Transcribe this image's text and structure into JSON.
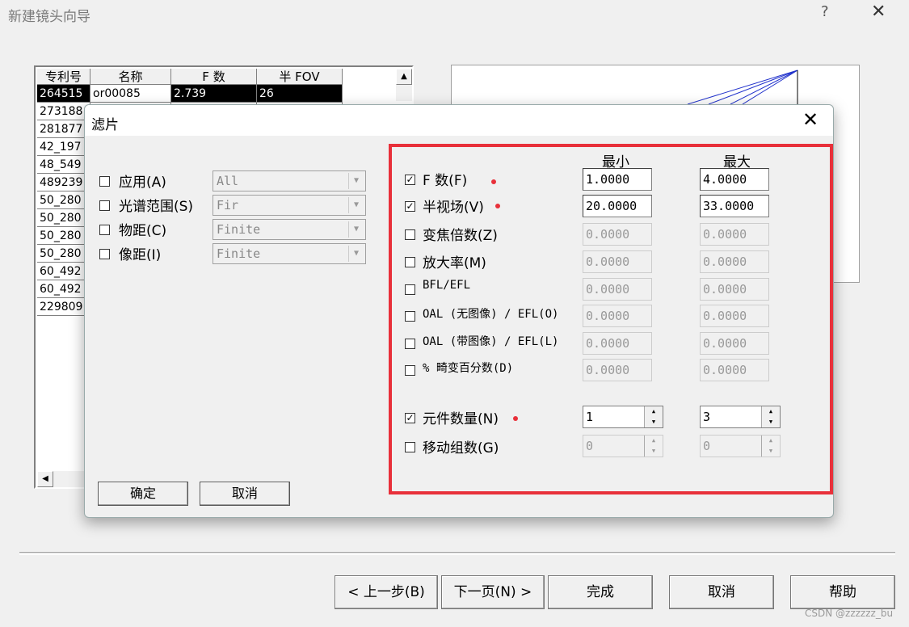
{
  "wizard": {
    "title": "新建镜头向导",
    "help_glyph": "?",
    "close_glyph": "✕",
    "buttons": {
      "prev": "< 上一步(B)",
      "next": "下一页(N) >",
      "finish": "完成",
      "cancel": "取消",
      "help": "帮助"
    }
  },
  "patent_table": {
    "columns": [
      "专利号",
      "名称",
      "F 数",
      "半 FOV"
    ],
    "rows": [
      [
        "264515",
        "or00085",
        "2.739",
        "26"
      ],
      [
        "273188",
        "",
        "",
        ""
      ],
      [
        "281877",
        "",
        "",
        ""
      ],
      [
        "42_197",
        "",
        "",
        ""
      ],
      [
        "48_549",
        "",
        "",
        ""
      ],
      [
        "489239",
        "",
        "",
        ""
      ],
      [
        "50_280",
        "",
        "",
        ""
      ],
      [
        "50_280",
        "",
        "",
        ""
      ],
      [
        "50_280",
        "",
        "",
        ""
      ],
      [
        "50_280",
        "",
        "",
        ""
      ],
      [
        "60_492",
        "",
        "",
        ""
      ],
      [
        "60_492",
        "",
        "",
        ""
      ],
      [
        "229809",
        "",
        "",
        ""
      ]
    ],
    "selected_row": 0,
    "scroll_up_glyph": "▲",
    "scroll_left_glyph": "◀"
  },
  "filter_dialog": {
    "title": "滤片",
    "close_glyph": "✕",
    "left_filters": [
      {
        "label": "应用(A)",
        "value": "All",
        "checked": false
      },
      {
        "label": "光谱范围(S)",
        "value": "Fir",
        "checked": false
      },
      {
        "label": "物距(C)",
        "value": "Finite",
        "checked": false
      },
      {
        "label": "像距(I)",
        "value": "Finite",
        "checked": false
      }
    ],
    "col_min": "最小",
    "col_max": "最大",
    "range_filters": [
      {
        "label": "F 数(F)",
        "checked": true,
        "min": "1.0000",
        "max": "4.0000",
        "enabled": true
      },
      {
        "label": "半视场(V)",
        "checked": true,
        "min": "20.0000",
        "max": "33.0000",
        "enabled": true
      },
      {
        "label": "变焦倍数(Z)",
        "checked": false,
        "min": "0.0000",
        "max": "0.0000",
        "enabled": false
      },
      {
        "label": "放大率(M)",
        "checked": false,
        "min": "0.0000",
        "max": "0.0000",
        "enabled": false
      },
      {
        "label": "BFL/EFL",
        "checked": false,
        "min": "0.0000",
        "max": "0.0000",
        "enabled": false
      },
      {
        "label": "OAL (无图像) / EFL(O)",
        "checked": false,
        "min": "0.0000",
        "max": "0.0000",
        "enabled": false
      },
      {
        "label": "OAL (带图像) / EFL(L)",
        "checked": false,
        "min": "0.0000",
        "max": "0.0000",
        "enabled": false
      },
      {
        "label": "% 畸变百分数(D)",
        "checked": false,
        "min": "0.0000",
        "max": "0.0000",
        "enabled": false
      }
    ],
    "count_filters": [
      {
        "label": "元件数量(N)",
        "checked": true,
        "min": "1",
        "max": "3",
        "enabled": true
      },
      {
        "label": "移动组数(G)",
        "checked": false,
        "min": "0",
        "max": "0",
        "enabled": false
      }
    ],
    "ok": "确定",
    "cancel": "取消",
    "checkmark": "✓",
    "combo_arrow": "▼",
    "spin_up": "▲",
    "spin_down": "▼"
  },
  "watermark": "CSDN @zzzzzz_bu",
  "colors": {
    "highlight_box": "#e8303a",
    "preview_lines": "#2233cc"
  }
}
